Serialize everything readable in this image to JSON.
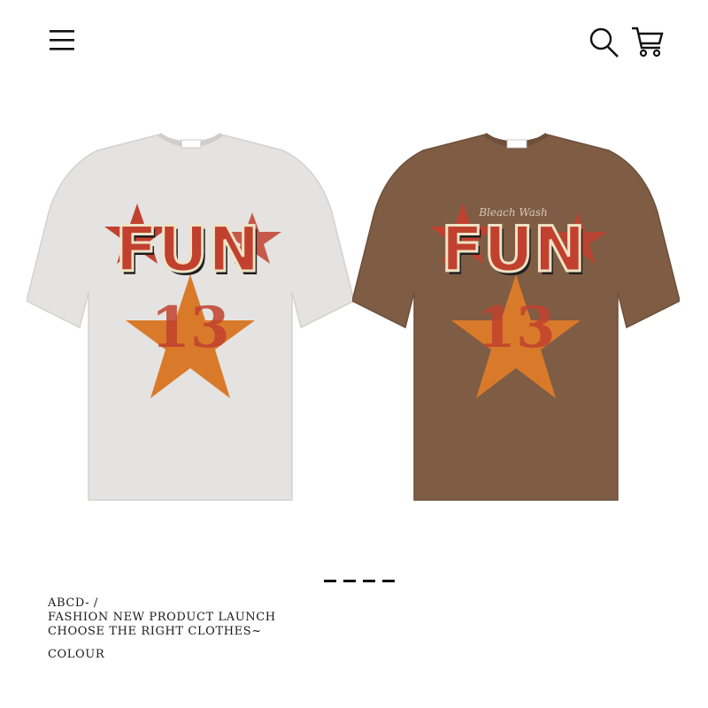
{
  "header": {
    "menu_icon": "hamburger-menu-icon",
    "search_icon": "search-icon",
    "cart_icon": "cart-icon"
  },
  "products": [
    {
      "colour": "#e4e3e1",
      "print_text": "FUN",
      "print_number": "13"
    },
    {
      "colour": "#7f5c44",
      "print_text": "FUN",
      "print_number": "13",
      "script_text": "Bleach Wash"
    }
  ],
  "pager": {
    "dots": 4
  },
  "caption": {
    "brand": "ABCD- /",
    "line1": "FASHION NEW PRODUCT LAUNCH",
    "line2": "CHOOSE THE RIGHT CLOTHES~",
    "colour_label": "COLOUR"
  },
  "colors": {
    "print_red": "#c1412e",
    "print_orange": "#d97a2b",
    "print_cream": "#efe3c7",
    "text": "#1a1a1a"
  }
}
